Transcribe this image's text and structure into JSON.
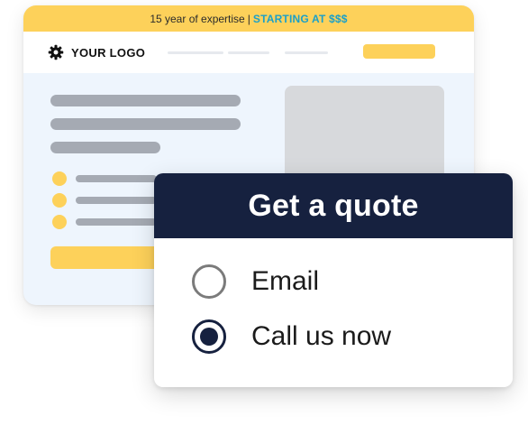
{
  "site_mockup": {
    "promo": {
      "text": "15 year of expertise",
      "separator": "|",
      "accent_text": "STARTING AT $$$"
    },
    "logo_text": "YOUR LOGO",
    "logo_icon": "gear-icon"
  },
  "quote_widget": {
    "title": "Get a quote",
    "options": [
      {
        "label": "Email",
        "selected": false
      },
      {
        "label": "Call us now",
        "selected": true
      }
    ]
  },
  "colors": {
    "brand_yellow": "#fdd15a",
    "accent_blue": "#1aa0c9",
    "navy": "#16213f",
    "skeleton_gray": "#a5aab3",
    "page_bg": "#eef5fd"
  }
}
